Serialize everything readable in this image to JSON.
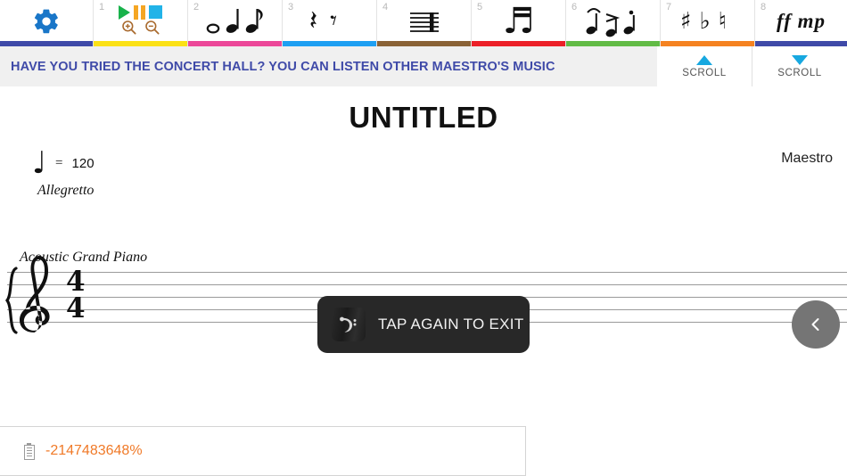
{
  "toolbar": {
    "settings": {
      "name": "gear-icon",
      "color": "#1976c8",
      "underline": "#3f4aa8"
    },
    "tabs": [
      {
        "num": "1",
        "underline": "#fbe116",
        "icons": [
          "play-icon",
          "pause-icon",
          "stop-icon",
          "zoom-in-icon",
          "zoom-out-icon"
        ],
        "glyphs": ""
      },
      {
        "num": "2",
        "underline": "#ec4899",
        "icons": [
          "whole-note-icon",
          "quarter-note-icon",
          "eighth-note-icon"
        ],
        "glyphs": "𝅝 ♪ ♮"
      },
      {
        "num": "3",
        "underline": "#1e9ff2",
        "icons": [
          "quarter-rest-icon",
          "eighth-rest-icon"
        ],
        "glyphs": "𝄽 𝄾"
      },
      {
        "num": "4",
        "underline": "#8a6236",
        "icons": [
          "staff-icon"
        ],
        "glyphs": "☰"
      },
      {
        "num": "5",
        "underline": "#ec2028",
        "icons": [
          "beamed-notes-icon"
        ],
        "glyphs": "♬"
      },
      {
        "num": "6",
        "underline": "#62bb46",
        "icons": [
          "fermata-icon",
          "accent-icon",
          "staccato-icon"
        ],
        "glyphs": ""
      },
      {
        "num": "7",
        "underline": "#f58220",
        "icons": [
          "sharp-icon",
          "flat-icon",
          "natural-icon"
        ],
        "glyphs": "♯ ♭ ♮"
      },
      {
        "num": "8",
        "underline": "#3f4aa8",
        "icons": [
          "dynamics-icon"
        ],
        "glyphs": "ff mp"
      }
    ]
  },
  "banner": {
    "text": "HAVE YOU TRIED THE CONCERT HALL? YOU CAN LISTEN OTHER MAESTRO'S MUSIC",
    "color": "#3f4aa8",
    "background": "#f0f0f0"
  },
  "scroll": {
    "up_label": "SCROLL",
    "down_label": "SCROLL",
    "arrow_color": "#17a8e0"
  },
  "score": {
    "title": "UNTITLED",
    "composer": "Maestro",
    "tempo": {
      "note": "♩",
      "equals": "=",
      "bpm": "120",
      "word": "Allegretto"
    },
    "instrument": "Acoustic Grand Piano",
    "clef": "𝄞",
    "brace": "{",
    "time_signature": {
      "top": "4",
      "bottom": "4"
    }
  },
  "toast": {
    "icon": "bass-clef-icon",
    "icon_glyph": "𝄢",
    "message": "TAP AGAIN TO EXIT"
  },
  "fab": {
    "icon": "chevron-left-icon",
    "glyph": "‹",
    "color": "#757575"
  },
  "status": {
    "icon": "battery-icon",
    "battery_text": "-2147483648%",
    "battery_color": "#f07a28"
  }
}
